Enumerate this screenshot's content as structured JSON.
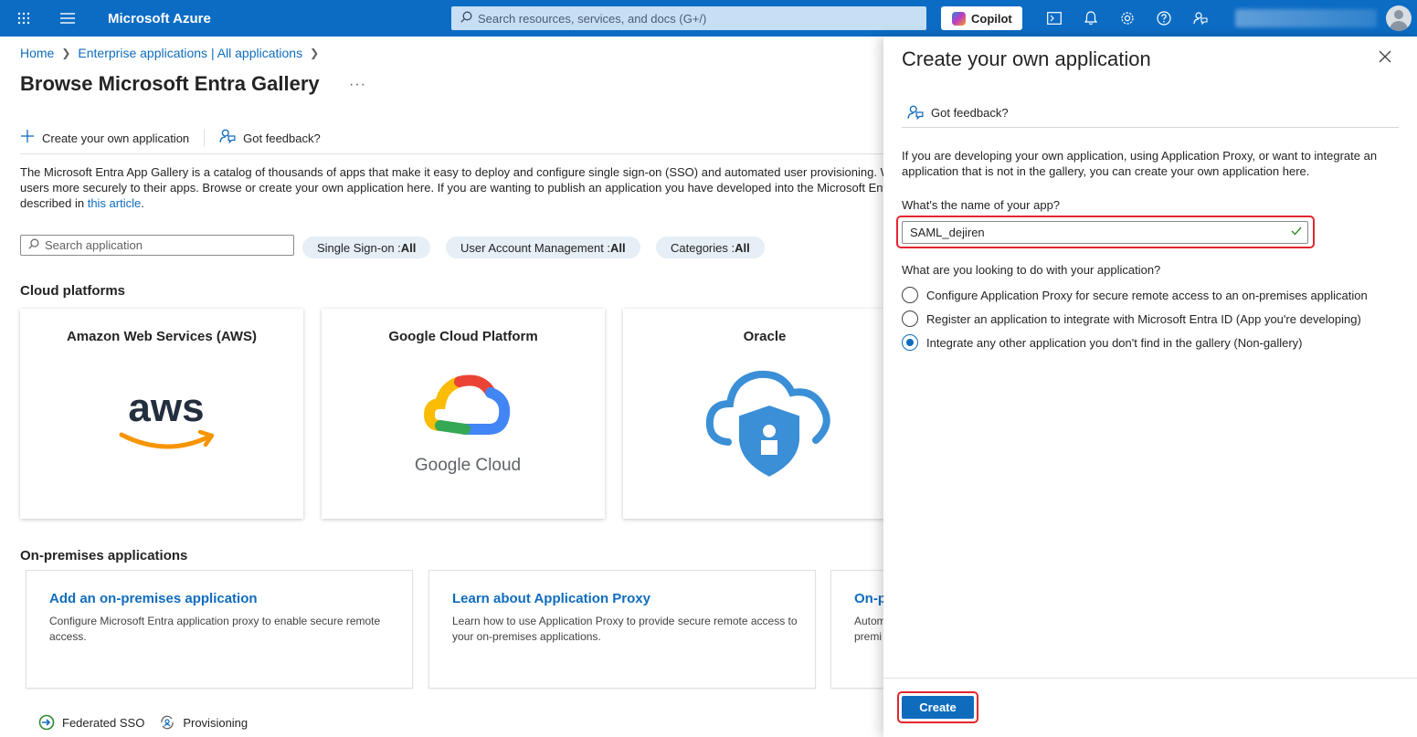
{
  "topbar": {
    "brand": "Microsoft Azure",
    "search_placeholder": "Search resources, services, and docs (G+/)",
    "copilot_label": "Copilot",
    "icons": [
      "app-launcher-icon",
      "hamburger-menu-icon",
      "cloud-shell-icon",
      "notifications-bell-icon",
      "settings-gear-icon",
      "help-icon",
      "feedback-icon"
    ]
  },
  "breadcrumb": {
    "items": [
      "Home",
      "Enterprise applications | All applications"
    ]
  },
  "page": {
    "title": "Browse Microsoft Entra Gallery",
    "more": "···"
  },
  "commands": {
    "create": "Create your own application",
    "feedback": "Got feedback?"
  },
  "description": {
    "line1": "The Microsoft Entra App Gallery is a catalog of thousands of apps that make it easy to deploy and configure single sign-on (SSO) and automated user provisioning. W",
    "line2": "users more securely to their apps. Browse or create your own application here. If you are wanting to publish an application you have developed into the Microsoft Ent",
    "line3_prefix": "described in ",
    "link": "this article",
    "line3_suffix": "."
  },
  "filters": {
    "search_placeholder": "Search application",
    "pills": [
      {
        "label": "Single Sign-on : ",
        "value": "All"
      },
      {
        "label": "User Account Management : ",
        "value": "All"
      },
      {
        "label": "Categories : ",
        "value": "All"
      }
    ]
  },
  "cloud": {
    "heading": "Cloud platforms",
    "cards": [
      {
        "name": "Amazon Web Services (AWS)",
        "logo_text": "aws"
      },
      {
        "name": "Google Cloud Platform",
        "logo_text": "Google Cloud"
      },
      {
        "name": "Oracle"
      }
    ]
  },
  "onprem": {
    "heading": "On-premises applications",
    "cards": [
      {
        "title": "Add an on-premises application",
        "desc": "Configure Microsoft Entra application proxy to enable secure remote access."
      },
      {
        "title": "Learn about Application Proxy",
        "desc": "Learn how to use Application Proxy to provide secure remote access to your on-premises applications."
      },
      {
        "title": "On-p",
        "desc": "Autom premi"
      }
    ]
  },
  "legend": {
    "items": [
      "Federated SSO",
      "Provisioning"
    ]
  },
  "panel": {
    "title": "Create your own application",
    "feedback": "Got feedback?",
    "intro": "If you are developing your own application, using Application Proxy, or want to integrate an application that is not in the gallery, you can create your own application here.",
    "name_label": "What's the name of your app?",
    "name_value": "SAML_dejiren",
    "purpose_label": "What are you looking to do with your application?",
    "options": [
      {
        "label": "Configure Application Proxy for secure remote access to an on-premises application",
        "selected": false
      },
      {
        "label": "Register an application to integrate with Microsoft Entra ID (App you're developing)",
        "selected": false
      },
      {
        "label": "Integrate any other application you don't find in the gallery (Non-gallery)",
        "selected": true
      }
    ],
    "create_label": "Create"
  },
  "colors": {
    "azure_blue": "#0c6cc4",
    "link_blue": "#0f6cbd",
    "highlight_red": "#e3262f"
  }
}
